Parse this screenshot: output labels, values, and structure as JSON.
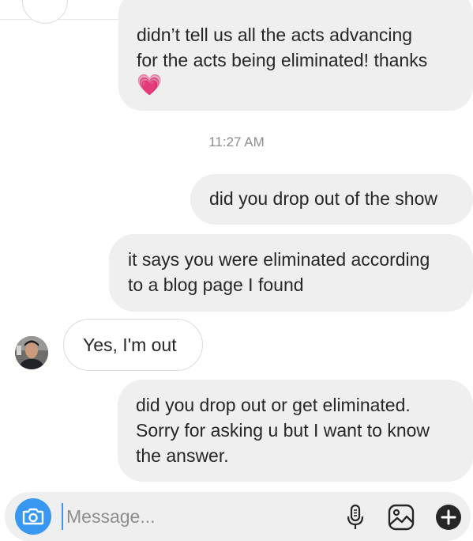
{
  "messages": [
    {
      "lines": [
        "didn’t tell us all the acts advancing",
        "for the acts being eliminated! thanks"
      ],
      "emoji": "💗"
    },
    {
      "lines": [
        "did you drop out of the show"
      ]
    },
    {
      "lines": [
        "it says you were eliminated according",
        "to a blog page I found"
      ]
    },
    {
      "lines": [
        "Yes, I'm out"
      ]
    },
    {
      "lines": [
        "did you drop out or get eliminated.",
        "Sorry for asking u but I want to know",
        "the answer."
      ]
    }
  ],
  "timestamp": "11:27 AM",
  "composer": {
    "placeholder": "Message..."
  },
  "icons": {
    "camera": "camera-icon",
    "microphone": "microphone-icon",
    "gallery": "gallery-icon",
    "add": "plus-circle-icon"
  },
  "colors": {
    "accent": "#3897f0",
    "bubble_out": "#efefef",
    "bubble_in_border": "#dbdbdb",
    "timestamp": "#8e8e8e"
  }
}
